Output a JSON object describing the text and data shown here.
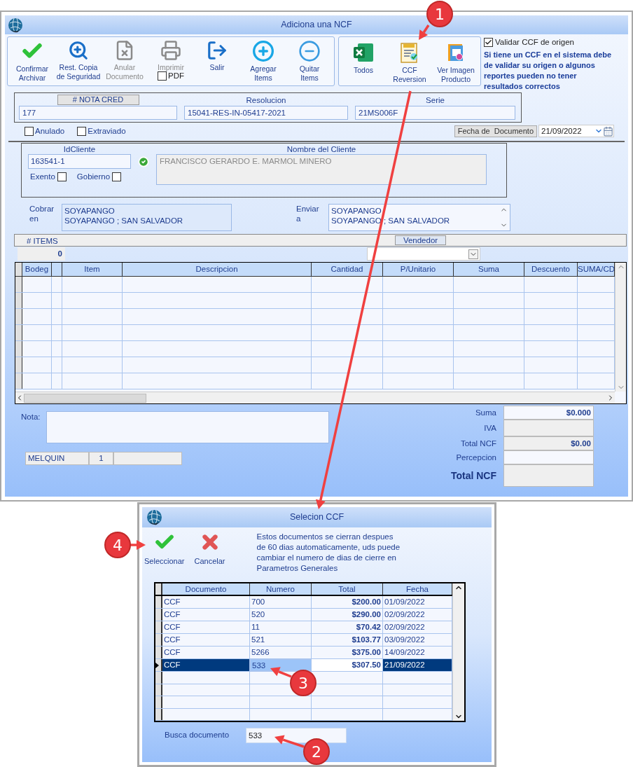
{
  "window": {
    "title": "Adiciona una NCF"
  },
  "toolbar_main": [
    {
      "label": "Confirmar\nArchivar",
      "disabled": false
    },
    {
      "label": "Rest. Copia\nde Seguridad",
      "disabled": false
    },
    {
      "label": "Anular\nDocumento",
      "disabled": true
    },
    {
      "label": "Imprimir",
      "disabled": true,
      "checkbox": {
        "label": "PDF",
        "checked": false
      }
    },
    {
      "label": "Salir",
      "disabled": false
    },
    {
      "label": "Agregar\nItems",
      "disabled": false
    },
    {
      "label": "Quitar\nItems",
      "disabled": false
    }
  ],
  "toolbar_reports": [
    {
      "label": "Todos"
    },
    {
      "label": "CCF\nReversion"
    },
    {
      "label": "Ver Imagen\nProducto"
    }
  ],
  "validation": {
    "checkbox": {
      "label": "Validar CCF de origen",
      "checked": true
    },
    "note": "Si tiene un CCF en el sistema debe\nde validar su origen o algunos\nreportes pueden no tener\nresultados correctos"
  },
  "document": {
    "fields": [
      {
        "label": "# NOTA CRED",
        "value": "177",
        "kind": "boxed"
      },
      {
        "label": "Resolucion",
        "value": "15041-RES-IN-05417-2021",
        "kind": "plain"
      },
      {
        "label": "Serie",
        "value": "21MS006F",
        "kind": "plain"
      }
    ],
    "flags": [
      {
        "label": "Anulado",
        "checked": false
      },
      {
        "label": "Extraviado",
        "checked": false
      }
    ],
    "date": {
      "label": "Fecha de  Documento",
      "value": "21/09/2022"
    }
  },
  "client": {
    "id": {
      "label": "IdCliente",
      "value": "163541-1"
    },
    "name": {
      "label": "Nombre del Cliente",
      "value": "FRANCISCO GERARDO E. MARMOL MINERO",
      "disabled": true
    },
    "flags": [
      {
        "label": "Exento",
        "checked": false
      },
      {
        "label": "Gobierno",
        "checked": false
      }
    ]
  },
  "addresses": [
    {
      "label": "Cobrar\nen",
      "value": "SOYAPANGO\nSOYAPANGO ; SAN SALVADOR",
      "kind": "plain"
    },
    {
      "label": "Enviar\na",
      "value": "SOYAPANGO\nSOYAPANGO ; SAN SALVADOR",
      "kind": "scroll"
    }
  ],
  "items_bar": {
    "count_label": "# ITEMS",
    "count": "0",
    "vendor_label": "Vendedor"
  },
  "grid": {
    "columns": [
      "Bodeg",
      "Item",
      "Descripcion",
      "Cantidad",
      "P/Unitario",
      "Suma",
      "Descuento",
      "SUMA/CD"
    ]
  },
  "note": {
    "label": "Nota:"
  },
  "footer_boxes": [
    "MELQUIN",
    "1"
  ],
  "totals": [
    {
      "label": "Suma",
      "value": "$0.000",
      "kind": "input"
    },
    {
      "label": "IVA",
      "kind": "readonly"
    },
    {
      "label": "Total NCF",
      "value": "$0.00",
      "kind": "readonly"
    },
    {
      "label": "Percepcion",
      "kind": "input"
    },
    {
      "label": "Total NCF",
      "kind": "grand"
    }
  ],
  "dialog": {
    "title": "Selecion CCF",
    "buttons": [
      {
        "label": "Seleccionar",
        "kind": "ok"
      },
      {
        "label": "Cancelar",
        "kind": "cancel"
      }
    ],
    "message": "Estos documentos se cierran despues\nde 60 dias automaticamente, uds puede\ncambiar el numero de dias de cierre en\nParametros Generales",
    "table": {
      "columns": [
        "Documento",
        "Numero",
        "Total",
        "Fecha"
      ],
      "rows": [
        {
          "cells": [
            "CCF",
            "700",
            "$200.00",
            "01/09/2022"
          ],
          "selected": false
        },
        {
          "cells": [
            "CCF",
            "520",
            "$290.00",
            "02/09/2022"
          ],
          "selected": false
        },
        {
          "cells": [
            "CCF",
            "11",
            "$70.42",
            "02/09/2022"
          ],
          "selected": false
        },
        {
          "cells": [
            "CCF",
            "521",
            "$103.77",
            "03/09/2022"
          ],
          "selected": false
        },
        {
          "cells": [
            "CCF",
            "5266",
            "$375.00",
            "14/09/2022"
          ],
          "selected": false
        },
        {
          "cells": [
            "CCF",
            "533",
            "$307.50",
            "21/09/2022"
          ],
          "selected": true
        }
      ]
    },
    "search": {
      "label": "Busca documento",
      "value": "533"
    }
  },
  "callouts": [
    {
      "number": "1"
    },
    {
      "number": "2"
    },
    {
      "number": "3"
    },
    {
      "number": "4"
    }
  ]
}
